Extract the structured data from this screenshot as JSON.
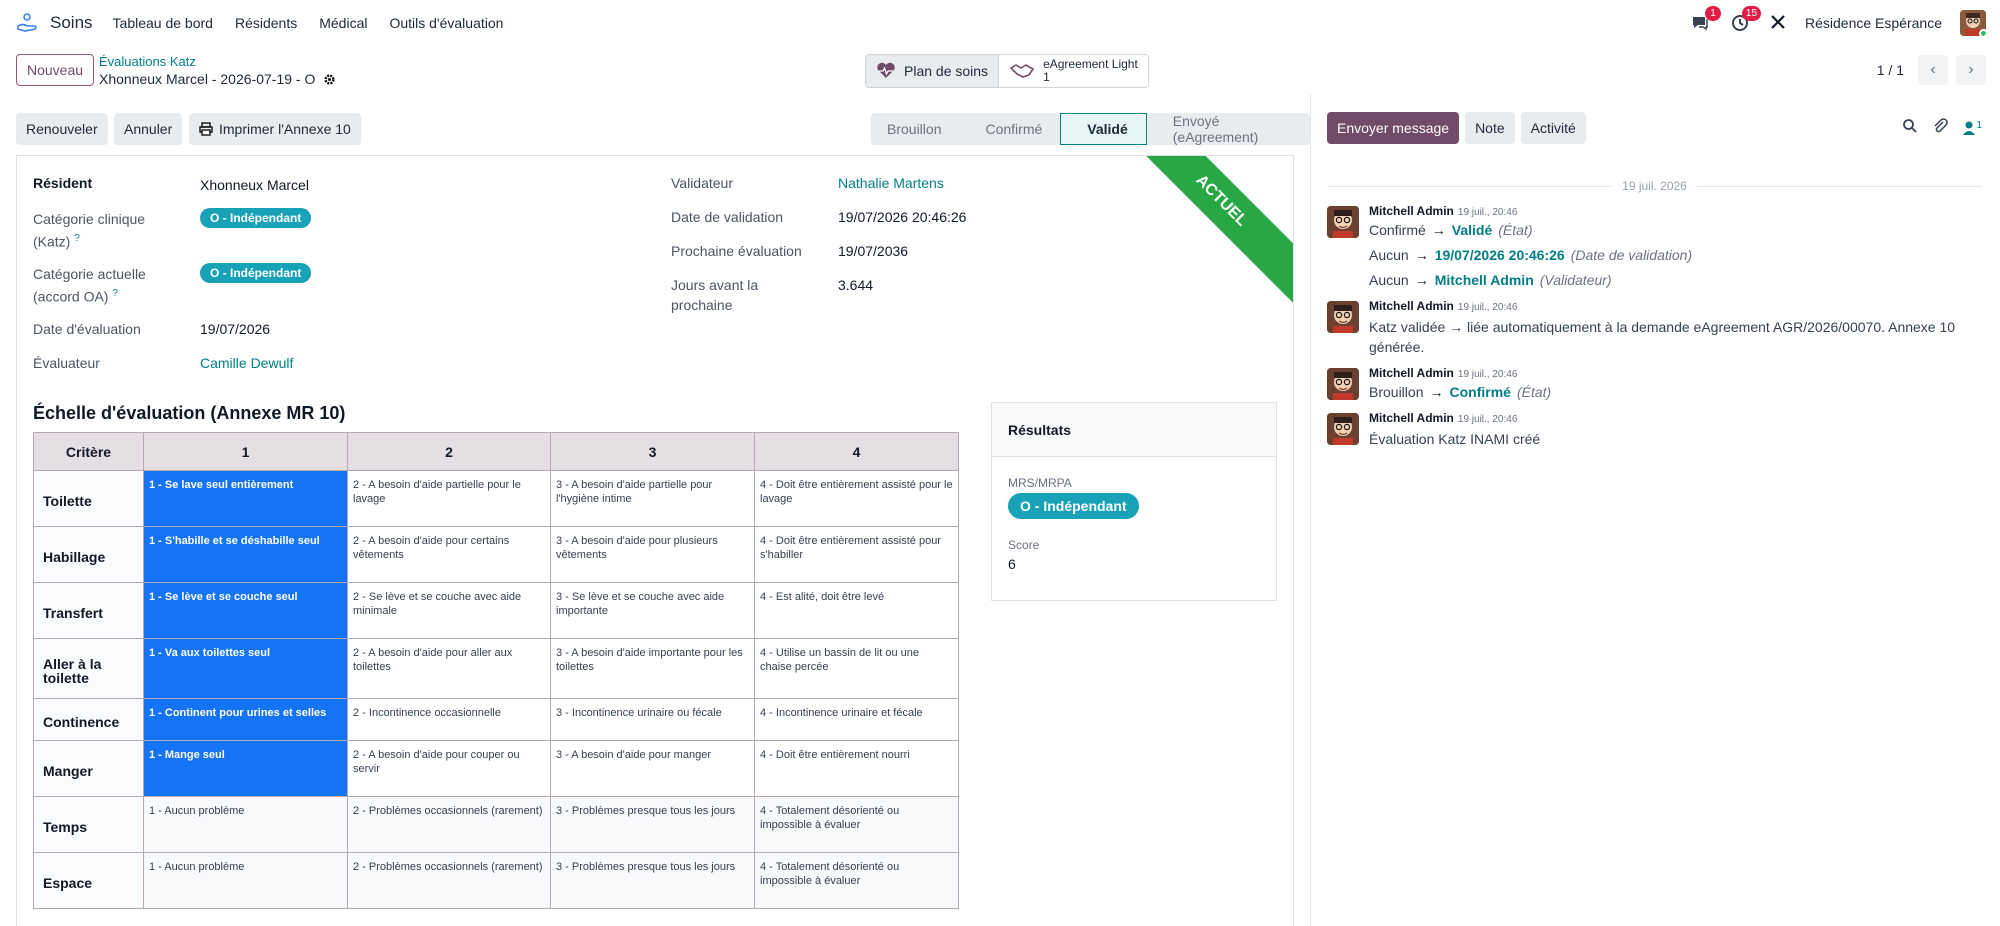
{
  "navbar": {
    "brand": "Soins",
    "menu": [
      "Tableau de bord",
      "Résidents",
      "Médical",
      "Outils d'évaluation"
    ],
    "messages_badge": "1",
    "activities_badge": "15",
    "company": "Résidence Espérance"
  },
  "control": {
    "new_label": "Nouveau",
    "breadcrumb_parent": "Évaluations Katz",
    "breadcrumb_current": "Xhonneux Marcel - 2026-07-19 - O",
    "smart_plan": "Plan de soins",
    "smart_agreement": "eAgreement Light",
    "smart_agreement_count": "1",
    "pager": "1 / 1"
  },
  "actions": {
    "renew": "Renouveler",
    "cancel": "Annuler",
    "print": "Imprimer l'Annexe 10"
  },
  "status": {
    "stages": [
      "Brouillon",
      "Confirmé",
      "Validé",
      "Envoyé (eAgreement)"
    ],
    "active": "Validé"
  },
  "form": {
    "ribbon": "ACTUEL",
    "left": {
      "resident_label": "Résident",
      "resident_value": "Xhonneux Marcel",
      "clinical_label_1": "Catégorie clinique",
      "clinical_label_2": "(Katz)",
      "clinical_value": "O - Indépendant",
      "current_label_1": "Catégorie actuelle",
      "current_label_2": "(accord OA)",
      "current_value": "O - Indépendant",
      "date_label": "Date d'évaluation",
      "date_value": "19/07/2026",
      "evaluator_label": "Évaluateur",
      "evaluator_value": "Camille Dewulf"
    },
    "right": {
      "validator_label": "Validateur",
      "validator_value": "Nathalie Martens",
      "validation_date_label": "Date de validation",
      "validation_date_value": "19/07/2026 20:46:26",
      "next_label": "Prochaine évaluation",
      "next_value": "19/07/2036",
      "days_label_1": "Jours avant la",
      "days_label_2": "prochaine",
      "days_value": "3.644"
    },
    "scale_title": "Échelle d'évaluation (Annexe MR 10)",
    "scale": {
      "headers": [
        "Critère",
        "1",
        "2",
        "3",
        "4"
      ],
      "rows": [
        {
          "crit": "Toilette",
          "cells": [
            "1 - Se lave seul entièrement",
            "2 - A besoin d'aide partielle pour le lavage",
            "3 - A besoin d'aide partielle pour l'hygiène intime",
            "4 - Doit être entièrement assisté pour le lavage"
          ],
          "selected": 1
        },
        {
          "crit": "Habillage",
          "cells": [
            "1 - S'habille et se déshabille seul",
            "2 - A besoin d'aide pour certains vêtements",
            "3 - A besoin d'aide pour plusieurs vêtements",
            "4 - Doit être entièrement assisté pour s'habiller"
          ],
          "selected": 1
        },
        {
          "crit": "Transfert",
          "cells": [
            "1 - Se lève et se couche seul",
            "2 - Se lève et se couche avec aide minimale",
            "3 - Se lève et se couche avec aide importante",
            "4 - Est alité, doit être levé"
          ],
          "selected": 1
        },
        {
          "crit": "Aller à la toilette",
          "cells": [
            "1 - Va aux toilettes seul",
            "2 - A besoin d'aide pour aller aux toilettes",
            "3 - A besoin d'aide importante pour les toilettes",
            "4 - Utilise un bassin de lit ou une chaise percée"
          ],
          "selected": 1
        },
        {
          "crit": "Continence",
          "cells": [
            "1 - Continent pour urines et selles",
            "2 - Incontinence occasionnelle",
            "3 - Incontinence urinaire ou fécale",
            "4 - Incontinence urinaire et fécale"
          ],
          "selected": 1
        },
        {
          "crit": "Manger",
          "cells": [
            "1 - Mange seul",
            "2 - A besoin d'aide pour couper ou servir",
            "3 - A besoin d'aide pour manger",
            "4 - Doit être entièrement nourri"
          ],
          "selected": 1
        },
        {
          "crit": "Temps",
          "cells": [
            "1 - Aucun problème",
            "2 - Problèmes occasionnels (rarement)",
            "3 - Problèmes presque tous les jours",
            "4 - Totalement désorienté ou impossible à évaluer"
          ],
          "selected": 0
        },
        {
          "crit": "Espace",
          "cells": [
            "1 - Aucun problème",
            "2 - Problèmes occasionnels (rarement)",
            "3 - Problèmes presque tous les jours",
            "4 - Totalement désorienté ou impossible à évaluer"
          ],
          "selected": 0
        }
      ]
    },
    "results": {
      "title": "Résultats",
      "category_label": "MRS/MRPA",
      "category_value": "O - Indépendant",
      "score_label": "Score",
      "score_value": "6"
    }
  },
  "chatter": {
    "send_message": "Envoyer message",
    "note": "Note",
    "activity": "Activité",
    "followers_count": "1",
    "date_separator": "19 juil. 2026",
    "arrow": "→",
    "messages": [
      {
        "author": "Mitchell Admin",
        "time": "19 juil., 20:46",
        "changes": [
          {
            "old": "Confirmé",
            "new": "Validé",
            "field": "(État)"
          },
          {
            "old": "Aucun",
            "new": "19/07/2026 20:46:26",
            "field": "(Date de validation)"
          },
          {
            "old": "Aucun",
            "new": "Mitchell Admin",
            "field": "(Validateur)"
          }
        ]
      },
      {
        "author": "Mitchell Admin",
        "time": "19 juil., 20:46",
        "body": "Katz validée → liée automatiquement à la demande eAgreement AGR/2026/00070. Annexe 10 générée."
      },
      {
        "author": "Mitchell Admin",
        "time": "19 juil., 20:46",
        "changes": [
          {
            "old": "Brouillon",
            "new": "Confirmé",
            "field": "(État)"
          }
        ]
      },
      {
        "author": "Mitchell Admin",
        "time": "19 juil., 20:46",
        "body": "Évaluation Katz INAMI créé"
      }
    ]
  }
}
